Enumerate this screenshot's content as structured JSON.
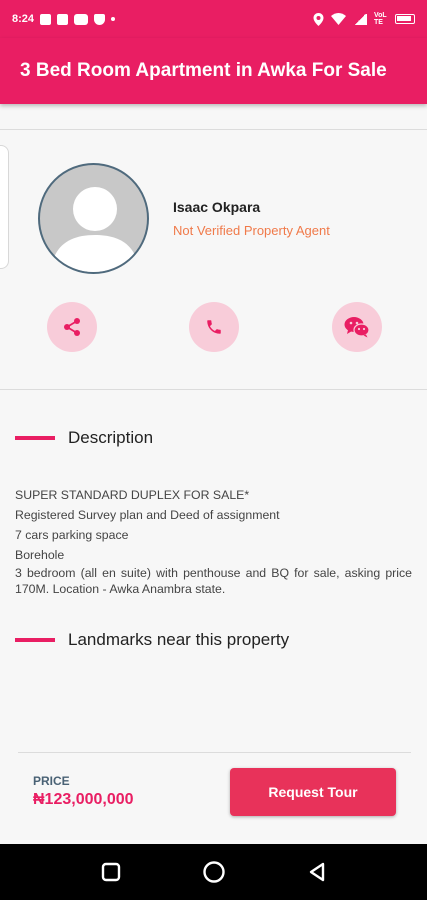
{
  "status_bar": {
    "time": "8:24",
    "network_label": "VoLTE",
    "icons": [
      "gallery-icon",
      "image-icon",
      "youtube-icon",
      "shield-icon",
      "dot-icon",
      "location-icon",
      "wifi-icon",
      "signal-icon",
      "battery-icon"
    ]
  },
  "app_bar": {
    "title": "3 Bed Room Apartment in Awka For Sale"
  },
  "agent": {
    "name": "Isaac Okpara",
    "status": "Not Verified Property Agent",
    "status_color": "#f07a4a"
  },
  "actions": [
    {
      "icon": "share-icon"
    },
    {
      "icon": "phone-icon"
    },
    {
      "icon": "wechat-icon"
    }
  ],
  "description": {
    "title": "Description",
    "lines": [
      "SUPER STANDARD DUPLEX FOR SALE*",
      "Registered Survey plan and Deed of assignment",
      "7 cars parking space",
      "Borehole",
      "3 bedroom (all en suite) with penthouse and BQ for sale, asking price 170M. Location - Awka Anambra state."
    ]
  },
  "landmarks": {
    "title": "Landmarks near this property"
  },
  "footer": {
    "price_label": "PRICE",
    "price_value": "₦123,000,000",
    "request_button": "Request Tour"
  },
  "colors": {
    "primary": "#e91e63",
    "button": "#e8325a",
    "action_circle": "#f8ccd9"
  },
  "nav": {
    "icons": [
      "recents-icon",
      "home-icon",
      "back-icon"
    ]
  }
}
